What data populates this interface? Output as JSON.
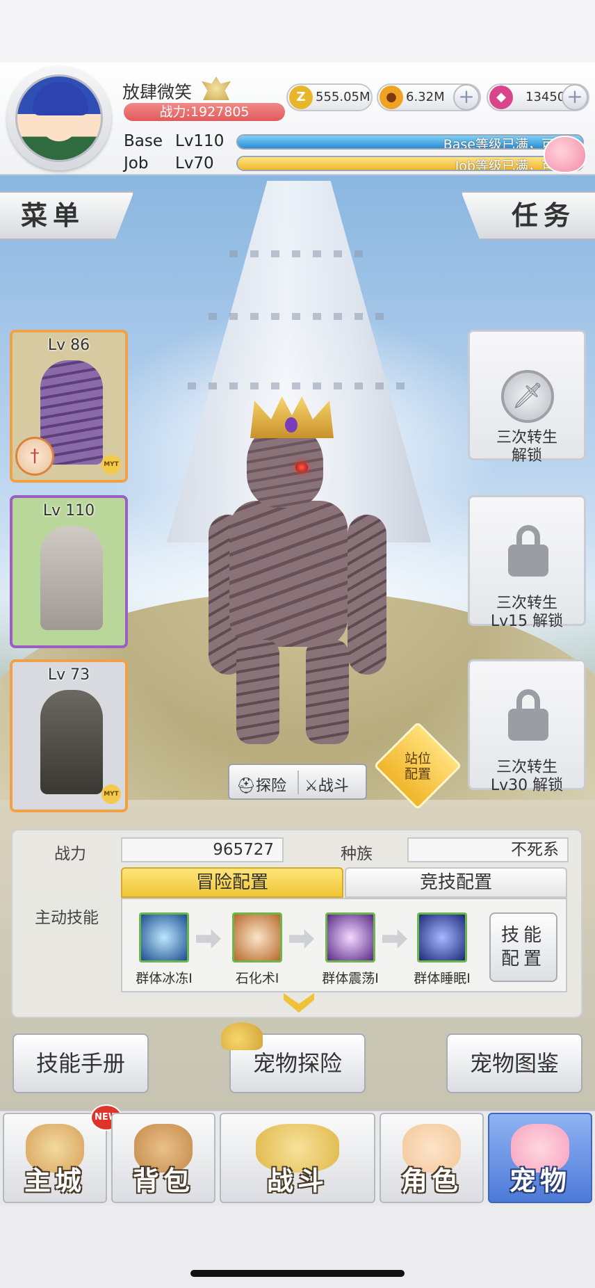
{
  "player": {
    "name": "放肆微笑",
    "power_text": "战力:1927805",
    "base_label": "Base",
    "base_level": "Lv110",
    "base_status": "Base等级已满，可",
    "job_label": "Job",
    "job_level": "Lv70",
    "job_status": "Job等级已满，可"
  },
  "currencies": [
    {
      "icon": "zeny-coin-icon",
      "value": "555.05M",
      "color": "#e9b62a"
    },
    {
      "icon": "gold-coin-icon",
      "value": "6.32M",
      "color": "#f0a323"
    },
    {
      "icon": "pink-crystal-icon",
      "value": "13450",
      "color": "#d9458c"
    }
  ],
  "tabs": {
    "menu": "菜单",
    "task": "任务"
  },
  "pets": [
    {
      "level": "Lv 86",
      "bg": "#d7c9a0",
      "sprite_color": "#8a6aa8"
    },
    {
      "level": "Lv 110",
      "bg": "#b9d79a",
      "sprite_color": "#b7b4ad"
    },
    {
      "level": "Lv 73",
      "bg": "#d8dadf",
      "sprite_color": "#4d4a45"
    }
  ],
  "locks": [
    {
      "line1": "三次转生",
      "line2": "解锁"
    },
    {
      "line1": "三次转生",
      "line2": "Lv15 解锁"
    },
    {
      "line1": "三次转生",
      "line2": "Lv30 解锁"
    }
  ],
  "actions_small": {
    "explore": "探险",
    "fight": "战斗",
    "station_line1": "站位",
    "station_line2": "配置"
  },
  "info": {
    "power_label": "战力",
    "power_value": "965727",
    "race_label": "种族",
    "race_value": "不死系",
    "skills_label": "主动技能",
    "tab_adventure": "冒险配置",
    "tab_arena": "竞技配置",
    "skill_config_line1": "技能",
    "skill_config_line2": "配置"
  },
  "skills": [
    {
      "name": "群体冰冻Ⅰ",
      "bg": "#1b4f8f"
    },
    {
      "name": "石化术Ⅰ",
      "bg": "#b8692c"
    },
    {
      "name": "群体震荡Ⅰ",
      "bg": "#5a2a86"
    },
    {
      "name": "群体睡眠Ⅰ",
      "bg": "#1d2a7a"
    }
  ],
  "buttons": {
    "skill_manual": "技能手册",
    "pet_explore": "宠物探险",
    "pet_guide": "宠物图鉴"
  },
  "nav": [
    {
      "label": "主城",
      "art_color": "#d7a35a"
    },
    {
      "label": "背包",
      "art_color": "#c58a4a"
    },
    {
      "label": "战斗",
      "art_color": "#e0b84a"
    },
    {
      "label": "角色",
      "art_color": "#f2c79a"
    },
    {
      "label": "宠物",
      "art_color": "#f7a3bd"
    }
  ],
  "new_badge": "NEW"
}
